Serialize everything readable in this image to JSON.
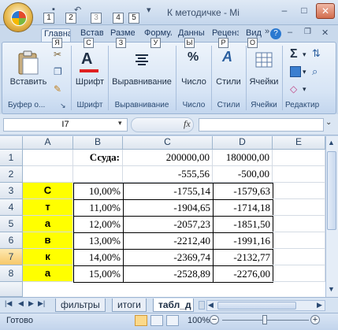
{
  "window": {
    "title": "К методичке - Mi",
    "minimize": "–",
    "maximize": "□",
    "close": "✕"
  },
  "quick_access": {
    "keys": [
      "1",
      "2",
      "3",
      "4",
      "5"
    ]
  },
  "ribbon_tabs": [
    {
      "label": "Главна",
      "key": "Я"
    },
    {
      "label": "Вставка",
      "key": "С"
    },
    {
      "label": "Разметка",
      "key": "З"
    },
    {
      "label": "Формулы",
      "key": "У"
    },
    {
      "label": "Данные",
      "key": "Ы"
    },
    {
      "label": "Рецензир",
      "key": "Р"
    },
    {
      "label": "Вид",
      "key": "О"
    }
  ],
  "ribbon": {
    "paste_label": "Вставить",
    "clipboard_label": "Буфер о...",
    "font_label": "Шрифт",
    "alignment_label": "Выравнивание",
    "number_label": "Число",
    "styles_label": "Стили",
    "cells_label": "Ячейки",
    "editing_label": "Редактир",
    "sigma": "Σ",
    "percent": "%"
  },
  "formula_bar": {
    "name_box": "I7",
    "fx": "fx",
    "value": ""
  },
  "columns": [
    "A",
    "B",
    "C",
    "D",
    "E"
  ],
  "rows": [
    "1",
    "2",
    "3",
    "4",
    "5",
    "6",
    "7",
    "8"
  ],
  "cells": {
    "B1": "Ссуда:",
    "C1": "200000,00",
    "D1": "180000,00",
    "C2": "-555,56",
    "D2": "-500,00",
    "A3": "С",
    "A4": "т",
    "A5": "а",
    "A6": "в",
    "A7": "к",
    "A8": "а",
    "B3": "10,00%",
    "B4": "11,00%",
    "B5": "12,00%",
    "B6": "13,00%",
    "B7": "14,00%",
    "B8": "15,00%",
    "C3": "-1755,14",
    "C4": "-1904,65",
    "C5": "-2057,23",
    "C6": "-2212,40",
    "C7": "-2369,74",
    "C8": "-2528,89",
    "D3": "-1579,63",
    "D4": "-1714,18",
    "D5": "-1851,50",
    "D6": "-1991,16",
    "D7": "-2132,77",
    "D8": "-2276,00"
  },
  "sheet_tabs": [
    "фильтры",
    "итоги",
    "табл_д"
  ],
  "status": {
    "ready": "Готово",
    "zoom": "100%"
  },
  "colors": {
    "highlight": "#ffff00",
    "selected_header": "#f7c86a"
  }
}
